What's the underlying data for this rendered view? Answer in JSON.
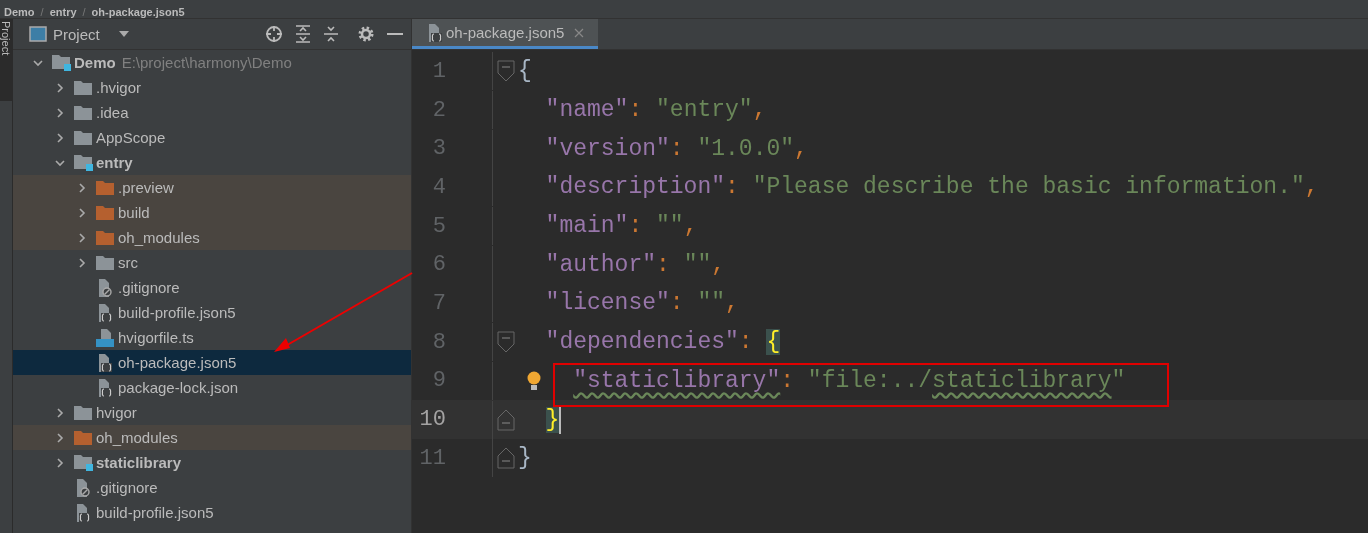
{
  "breadcrumb": {
    "separator": "/",
    "items": [
      "Demo",
      "entry",
      "oh-package.json5"
    ]
  },
  "tool_strip": {
    "label": "Project"
  },
  "project_panel": {
    "title": "Project",
    "tree": [
      {
        "label": "Demo",
        "path": "E:\\project\\harmony\\Demo",
        "kind": "module",
        "expanded": true,
        "excluded": false,
        "selected": false,
        "children": [
          {
            "label": ".hvigor",
            "kind": "folder",
            "expanded": false,
            "excluded": false,
            "selected": false
          },
          {
            "label": ".idea",
            "kind": "folder",
            "expanded": false,
            "excluded": false,
            "selected": false
          },
          {
            "label": "AppScope",
            "kind": "folder",
            "expanded": false,
            "excluded": false,
            "selected": false
          },
          {
            "label": "entry",
            "kind": "module",
            "expanded": true,
            "excluded": false,
            "selected": false,
            "children": [
              {
                "label": ".preview",
                "kind": "folder",
                "expanded": false,
                "excluded": true,
                "selected": false
              },
              {
                "label": "build",
                "kind": "folder",
                "expanded": false,
                "excluded": true,
                "selected": false
              },
              {
                "label": "oh_modules",
                "kind": "folder",
                "expanded": false,
                "excluded": true,
                "selected": false
              },
              {
                "label": "src",
                "kind": "folder",
                "expanded": false,
                "excluded": false,
                "selected": false
              },
              {
                "label": ".gitignore",
                "kind": "ignore-file",
                "excluded": false,
                "selected": false
              },
              {
                "label": "build-profile.json5",
                "kind": "json-file",
                "excluded": false,
                "selected": false
              },
              {
                "label": "hvigorfile.ts",
                "kind": "ts-file",
                "excluded": false,
                "selected": false
              },
              {
                "label": "oh-package.json5",
                "kind": "json-file",
                "excluded": false,
                "selected": true
              },
              {
                "label": "package-lock.json",
                "kind": "json-file",
                "excluded": false,
                "selected": false
              }
            ]
          },
          {
            "label": "hvigor",
            "kind": "folder",
            "expanded": false,
            "excluded": false,
            "selected": false
          },
          {
            "label": "oh_modules",
            "kind": "folder",
            "expanded": false,
            "excluded": true,
            "selected": false
          },
          {
            "label": "staticlibrary",
            "kind": "module",
            "expanded": false,
            "excluded": false,
            "selected": false
          },
          {
            "label": ".gitignore",
            "kind": "ignore-file",
            "excluded": false,
            "selected": false
          },
          {
            "label": "build-profile.json5",
            "kind": "json-file",
            "excluded": false,
            "selected": false
          }
        ]
      }
    ]
  },
  "editor": {
    "tabs": [
      {
        "label": "oh-package.json5",
        "selected": true
      }
    ],
    "lines": [
      {
        "number": "1",
        "current": false,
        "fold_start": true,
        "tokens": [
          {
            "kind": "brace",
            "text": "{",
            "matched": false
          }
        ]
      },
      {
        "number": "2",
        "current": false,
        "tokens": [
          {
            "kind": "key",
            "text": "\"name\""
          },
          {
            "kind": "punct",
            "text": ": "
          },
          {
            "kind": "string",
            "text": "\"entry\""
          },
          {
            "kind": "comma",
            "text": ","
          }
        ]
      },
      {
        "number": "3",
        "current": false,
        "tokens": [
          {
            "kind": "key",
            "text": "\"version\""
          },
          {
            "kind": "punct",
            "text": ": "
          },
          {
            "kind": "string",
            "text": "\"1.0.0\""
          },
          {
            "kind": "comma",
            "text": ","
          }
        ]
      },
      {
        "number": "4",
        "current": false,
        "tokens": [
          {
            "kind": "key",
            "text": "\"description\""
          },
          {
            "kind": "punct",
            "text": ": "
          },
          {
            "kind": "string",
            "text": "\"Please describe the basic information.\""
          },
          {
            "kind": "comma",
            "text": ","
          }
        ]
      },
      {
        "number": "5",
        "current": false,
        "tokens": [
          {
            "kind": "key",
            "text": "\"main\""
          },
          {
            "kind": "punct",
            "text": ": "
          },
          {
            "kind": "string",
            "text": "\"\""
          },
          {
            "kind": "comma",
            "text": ","
          }
        ]
      },
      {
        "number": "6",
        "current": false,
        "tokens": [
          {
            "kind": "key",
            "text": "\"author\""
          },
          {
            "kind": "punct",
            "text": ": "
          },
          {
            "kind": "string",
            "text": "\"\""
          },
          {
            "kind": "comma",
            "text": ","
          }
        ]
      },
      {
        "number": "7",
        "current": false,
        "tokens": [
          {
            "kind": "key",
            "text": "\"license\""
          },
          {
            "kind": "punct",
            "text": ": "
          },
          {
            "kind": "string",
            "text": "\"\""
          },
          {
            "kind": "comma",
            "text": ","
          }
        ]
      },
      {
        "number": "8",
        "current": false,
        "fold_start": true,
        "tokens": [
          {
            "kind": "key",
            "text": "\"dependencies\""
          },
          {
            "kind": "punct",
            "text": ": "
          },
          {
            "kind": "brace",
            "text": "{",
            "matched": true
          }
        ]
      },
      {
        "number": "9",
        "current": false,
        "bulb": true,
        "boxed": true,
        "tokens": [
          {
            "kind": "key",
            "text": "\"staticlibrary\"",
            "warning": true
          },
          {
            "kind": "punct",
            "text": ": "
          },
          {
            "kind": "string",
            "text": "\"file:../"
          },
          {
            "kind": "string",
            "text": "staticlibrary",
            "warning": true
          },
          {
            "kind": "string",
            "text": "\""
          }
        ]
      },
      {
        "number": "10",
        "current": true,
        "fold_end": true,
        "tokens": [
          {
            "kind": "brace",
            "text": "}",
            "matched": true
          }
        ]
      },
      {
        "number": "11",
        "current": false,
        "fold_end": true,
        "tokens": [
          {
            "kind": "brace",
            "text": "}",
            "matched": false
          }
        ]
      }
    ]
  }
}
